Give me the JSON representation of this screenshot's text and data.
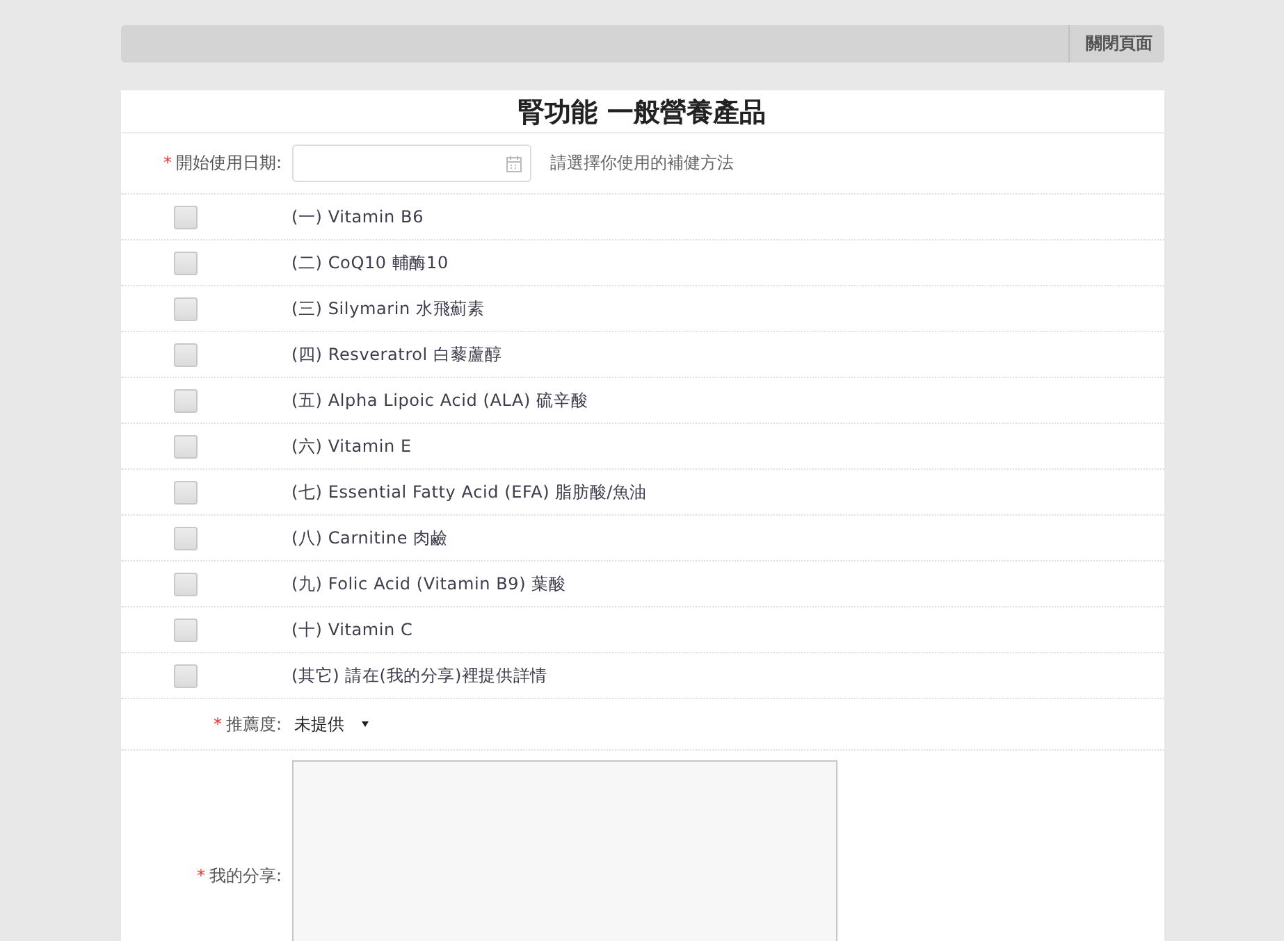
{
  "top_bar": {
    "close_button": "關閉頁面"
  },
  "title": "腎功能 一般營養產品",
  "start_date": {
    "required_mark": "*",
    "label": "開始使用日期:",
    "hint": "請選擇你使用的補健方法"
  },
  "supplements": [
    {
      "label": "(一) Vitamin B6",
      "checked": false
    },
    {
      "label": "(二) CoQ10 輔酶10",
      "checked": false
    },
    {
      "label": "(三) Silymarin 水飛薊素",
      "checked": false
    },
    {
      "label": "(四) Resveratrol 白藜蘆醇",
      "checked": false
    },
    {
      "label": "(五) Alpha Lipoic Acid (ALA) 硫辛酸",
      "checked": false
    },
    {
      "label": "(六) Vitamin E",
      "checked": false
    },
    {
      "label": "(七) Essential Fatty Acid (EFA) 脂肪酸/魚油",
      "checked": false
    },
    {
      "label": "(八) Carnitine 肉鹼",
      "checked": false
    },
    {
      "label": "(九) Folic Acid (Vitamin B9) 葉酸",
      "checked": false
    },
    {
      "label": "(十) Vitamin C",
      "checked": false
    },
    {
      "label": "(其它) 請在(我的分享)裡提供詳情",
      "checked": false
    }
  ],
  "rating": {
    "required_mark": "*",
    "label": "推薦度:",
    "value": "未提供"
  },
  "share": {
    "required_mark": "*",
    "label": "我的分享:"
  }
}
